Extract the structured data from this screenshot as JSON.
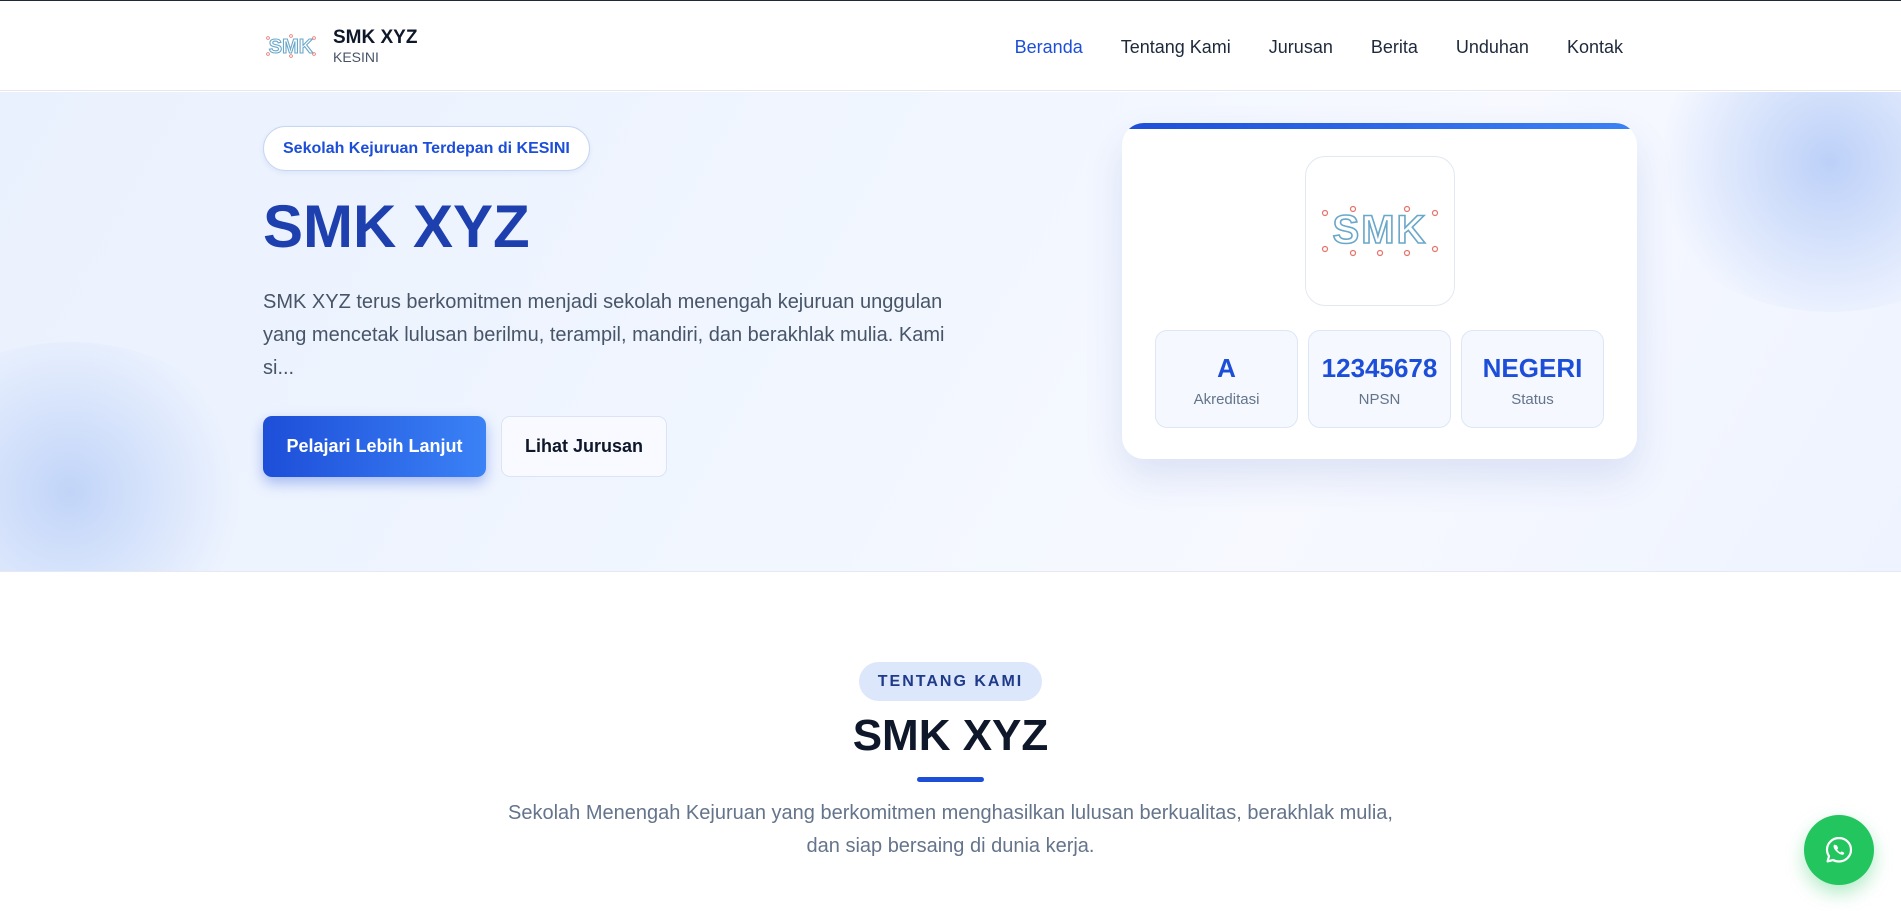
{
  "header": {
    "brand_name": "SMK XYZ",
    "brand_sub": "KESINI",
    "logo_icon": "smk-logo-icon",
    "nav": [
      {
        "label": "Beranda",
        "active": true
      },
      {
        "label": "Tentang Kami",
        "active": false
      },
      {
        "label": "Jurusan",
        "active": false
      },
      {
        "label": "Berita",
        "active": false
      },
      {
        "label": "Unduhan",
        "active": false
      },
      {
        "label": "Kontak",
        "active": false
      }
    ]
  },
  "hero": {
    "tagline": "Sekolah Kejuruan Terdepan di KESINI",
    "title": "SMK XYZ",
    "description": "SMK XYZ terus berkomitmen menjadi sekolah menengah kejuruan unggulan yang mencetak lulusan berilmu, terampil, mandiri, dan berakhlak mulia. Kami si...",
    "primary_button": "Pelajari Lebih Lanjut",
    "secondary_button": "Lihat Jurusan",
    "card": {
      "logo_icon": "smk-logo-icon",
      "stats": [
        {
          "value": "A",
          "label": "Akreditasi"
        },
        {
          "value": "12345678",
          "label": "NPSN"
        },
        {
          "value": "NEGERI",
          "label": "Status"
        }
      ]
    }
  },
  "about": {
    "badge": "TENTANG KAMI",
    "title": "SMK XYZ",
    "description": "Sekolah Menengah Kejuruan yang berkomitmen menghasilkan lulusan berkualitas, berakhlak mulia, dan siap bersaing di dunia kerja."
  },
  "floating": {
    "whatsapp_icon": "whatsapp-icon"
  },
  "colors": {
    "accent": "#1d4ed8",
    "title": "#1e40af",
    "whatsapp": "#22c55e"
  }
}
